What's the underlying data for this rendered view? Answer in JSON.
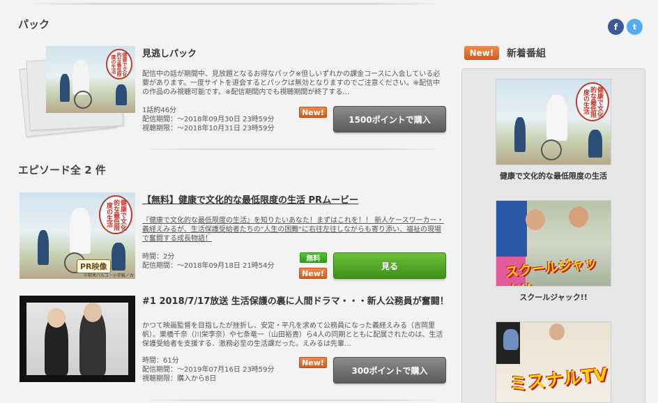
{
  "social": {
    "facebook": "f",
    "twitter": "t"
  },
  "pack_section": {
    "title": "パック",
    "pack": {
      "name": "見逃しパック",
      "desc": "配信中の話が期間中、見放題となるお得なパック※但しいずれかの課金コースに入会している必要があります。一度サイトを退会するとパックは無効となりますのでご注意ください。※配信中の作品のみ視聴可能です。※配信期間内でも視聴期間が終了する…",
      "count": "1話約46分",
      "delivery": "配信期間：～2018年09月30日 23時59分",
      "view": "視聴期限：～2018年10月31日 23時59分",
      "badge": "New!",
      "button": "1500ポイントで購入",
      "seal_text": "健康で文化的な最低限度の生活"
    }
  },
  "episodes_section": {
    "title": "エピソード全 2 件",
    "episodes": [
      {
        "title": "【無料】健康で文化的な最低限度の生活 PRムービー",
        "desc": "『健康で文化的な最低限度の生活』を知りたいあなた！まずはこれを！！ 新人ケースワーカー・義経えみるが、生活保護受給者たちの\"人生の困難\"に右往左往しながらも寄り添い、福祉の現場で奮闘する成長物語！",
        "time": "時間：2分",
        "delivery": "配信期間：～2018年09月18日 21時54分",
        "badge_free": "無料",
        "badge_new": "New!",
        "button": "見る",
        "overlay": "PR映像",
        "copyright": "©柏木ハルコ・小学館／カンテレ"
      },
      {
        "title": "#1 2018/7/17放送 生活保護の裏に人間ドラマ・・・新人公務員が奮闘！",
        "desc": "かつて映画監督を目指したが挫折し、安定・平凡を求めて公務員になった義経えみる（吉岡里帆）。栗橋千奈（川栄李奈）や七条竜一（山田裕貴）ら4人の同期とともに配属されたのは、生活保護受給者を支援する、激務必至の生活課だった。えみるは先輩…",
        "time": "時間：61分",
        "delivery": "配信期間：～2019年07月16日 23時59分",
        "view": "視聴期限：購入から8日",
        "badge_new": "New!",
        "button": "300ポイントで購入"
      }
    ]
  },
  "sidebar": {
    "label": "New!",
    "title": "新着番組",
    "items": [
      {
        "caption": "健康で文化的な最低限度の生活"
      },
      {
        "caption": "スクールジャック!!",
        "logo": "スクールジャック!!"
      },
      {
        "caption": "",
        "logo": "ミスナルTV"
      }
    ]
  },
  "colors": {
    "accent_new": "#d25b1f",
    "accent_free": "#339a1d",
    "button_gray": "#5a5a5a",
    "button_green": "#3d8f17",
    "sns_facebook": "#3b5998",
    "sns_twitter": "#55acee"
  }
}
